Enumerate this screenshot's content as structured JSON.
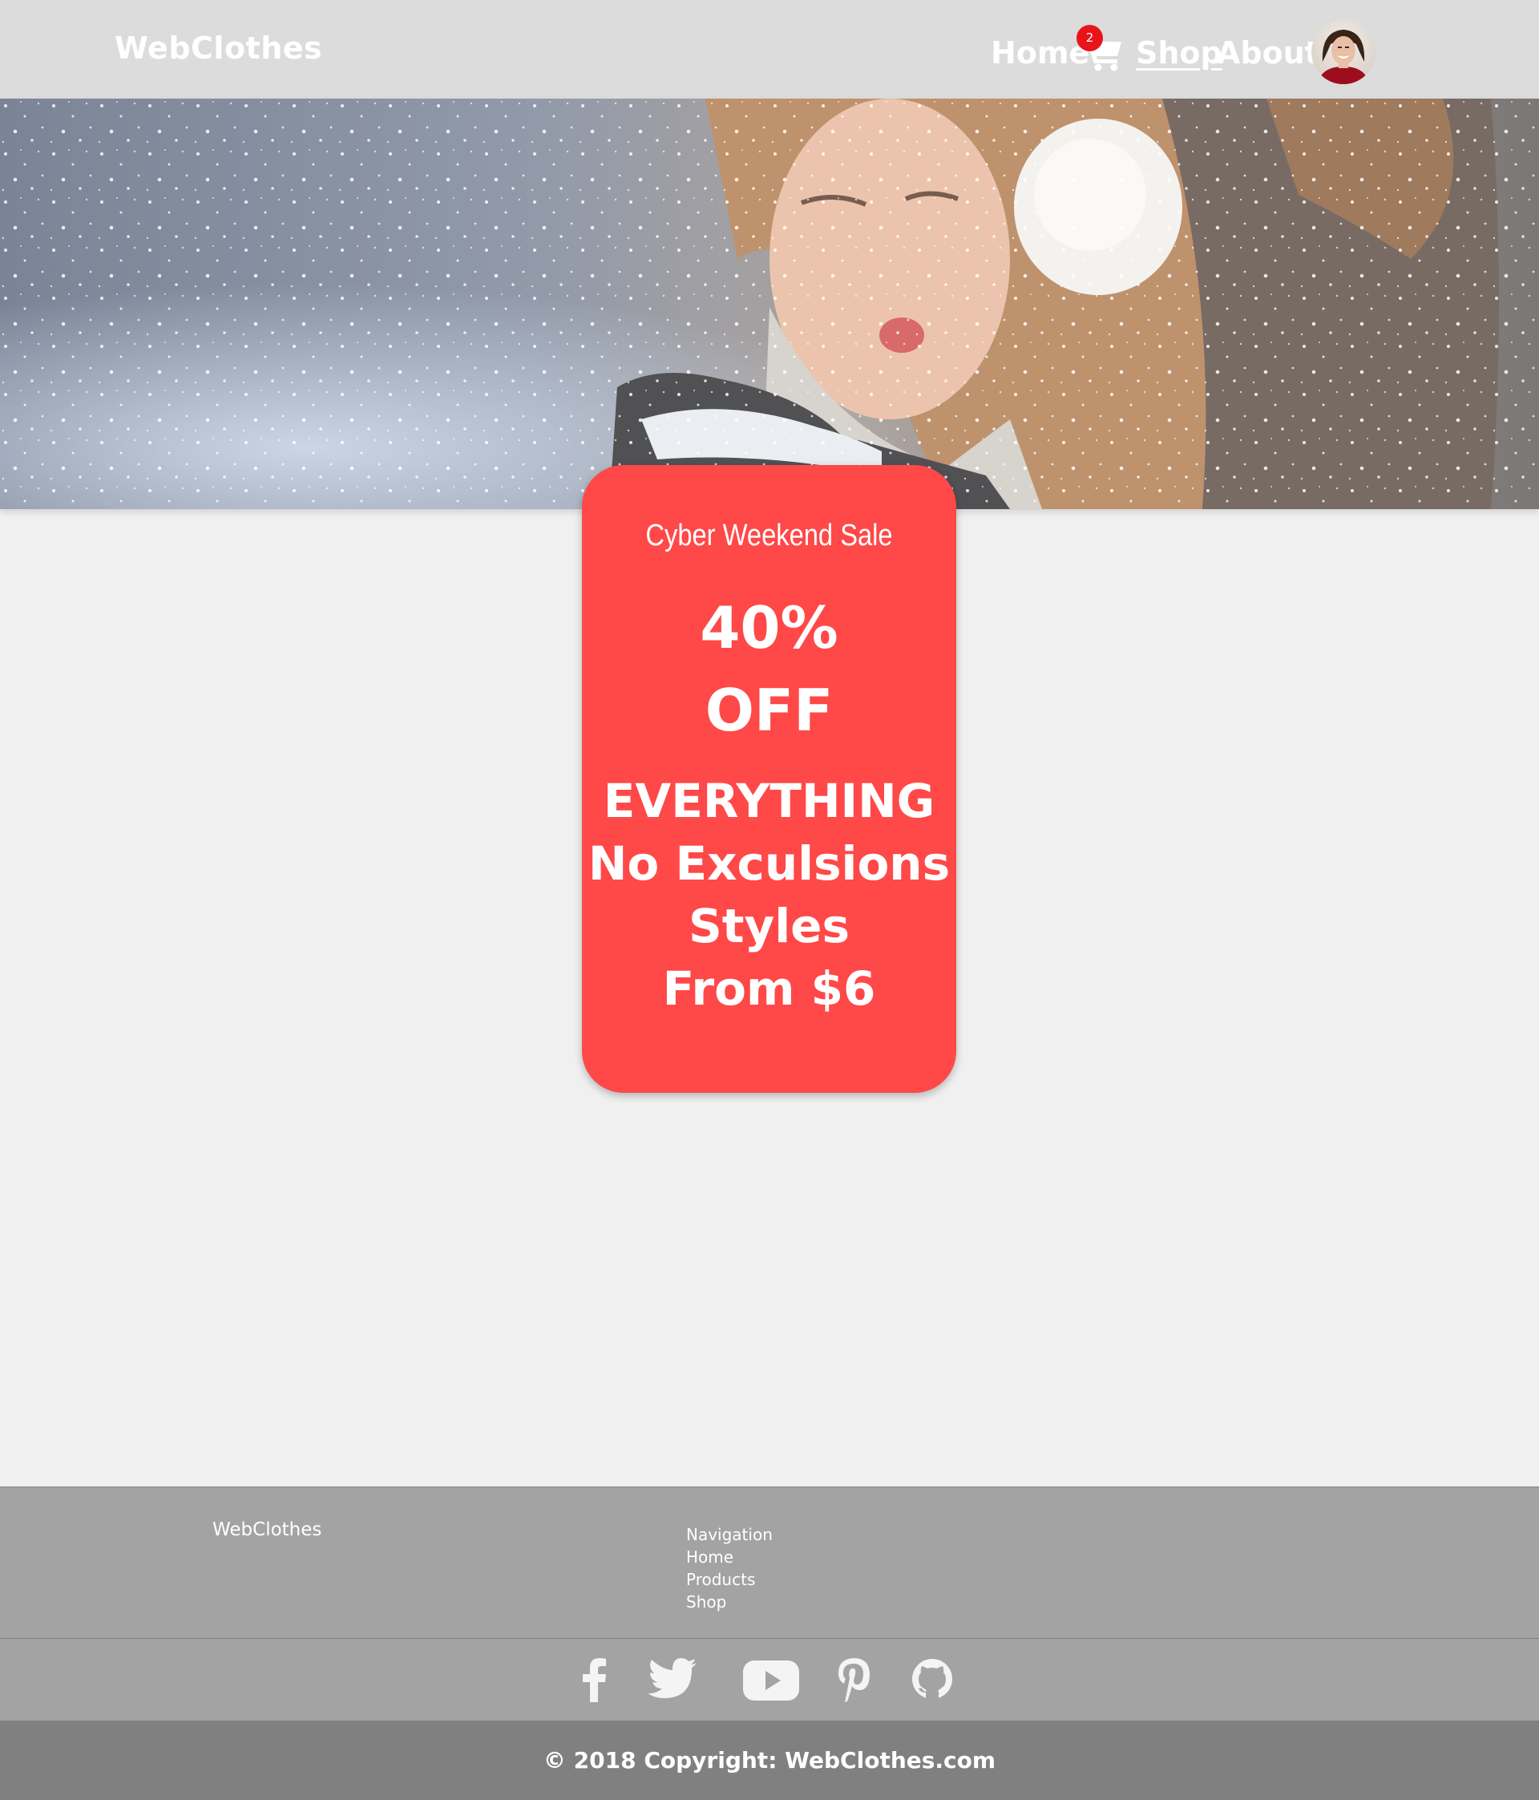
{
  "header": {
    "logo": "WebClothes",
    "nav": {
      "home": "Home",
      "shop": "Shop",
      "about": "About"
    },
    "cart_count": "2",
    "icons": [
      "cart-icon",
      "avatar"
    ]
  },
  "promo": {
    "title": "Cyber Weekend Sale",
    "percent": "40%",
    "off": "OFF",
    "line1": "EVERYTHING",
    "line2": "No Exculsions",
    "line3": "Styles",
    "line4": "From $6"
  },
  "footer": {
    "brand": "WebClothes",
    "nav_heading": "Navigation",
    "nav_links": [
      "Home",
      "Products",
      "Shop"
    ],
    "social": [
      "facebook-icon",
      "twitter-icon",
      "youtube-icon",
      "pinterest-icon",
      "github-icon"
    ],
    "copyright": "© 2018 Copyright: WebClothes.com"
  },
  "colors": {
    "header_bg": "#dcdcdc",
    "promo_bg": "#ff4848",
    "badge": "#e8141a",
    "footer_bg": "#a3a3a3",
    "copyright_bg": "#808080"
  }
}
